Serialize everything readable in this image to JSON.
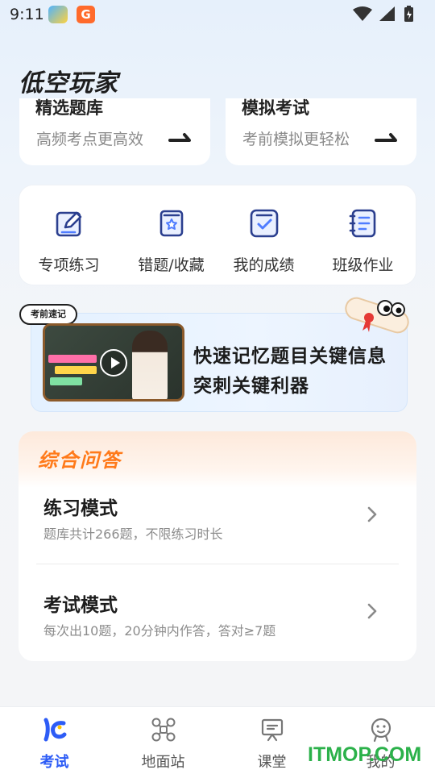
{
  "status_bar": {
    "time": "9:11"
  },
  "app": {
    "title": "低空玩家"
  },
  "top_cards": [
    {
      "title": "精选题库",
      "subtitle": "高频考点更高效"
    },
    {
      "title": "模拟考试",
      "subtitle": "考前模拟更轻松"
    }
  ],
  "features": [
    {
      "label": "专项练习",
      "icon": "edit-icon"
    },
    {
      "label": "错题/收藏",
      "icon": "bookmark-book-icon"
    },
    {
      "label": "我的成绩",
      "icon": "checkbox-icon"
    },
    {
      "label": "班级作业",
      "icon": "list-icon"
    }
  ],
  "banner": {
    "tag": "考前速记",
    "line1": "快速记忆题目关键信息",
    "line2": "突刺关键利器"
  },
  "qa": {
    "title": "综合问答",
    "modes": [
      {
        "title": "练习模式",
        "desc": "题库共计266题，不限练习时长"
      },
      {
        "title": "考试模式",
        "desc": "每次出10题，20分钟内作答，答对≥7题"
      }
    ]
  },
  "tabs": [
    {
      "label": "考试",
      "icon": "exam-icon",
      "active": true
    },
    {
      "label": "地面站",
      "icon": "drone-icon",
      "active": false
    },
    {
      "label": "课堂",
      "icon": "presentation-icon",
      "active": false
    },
    {
      "label": "我的",
      "icon": "profile-icon",
      "active": false
    }
  ],
  "watermark": "ITMOP.COM",
  "colors": {
    "accent": "#2d5cf6",
    "orange": "#ff7a1a",
    "watermark": "#2bb14a"
  }
}
